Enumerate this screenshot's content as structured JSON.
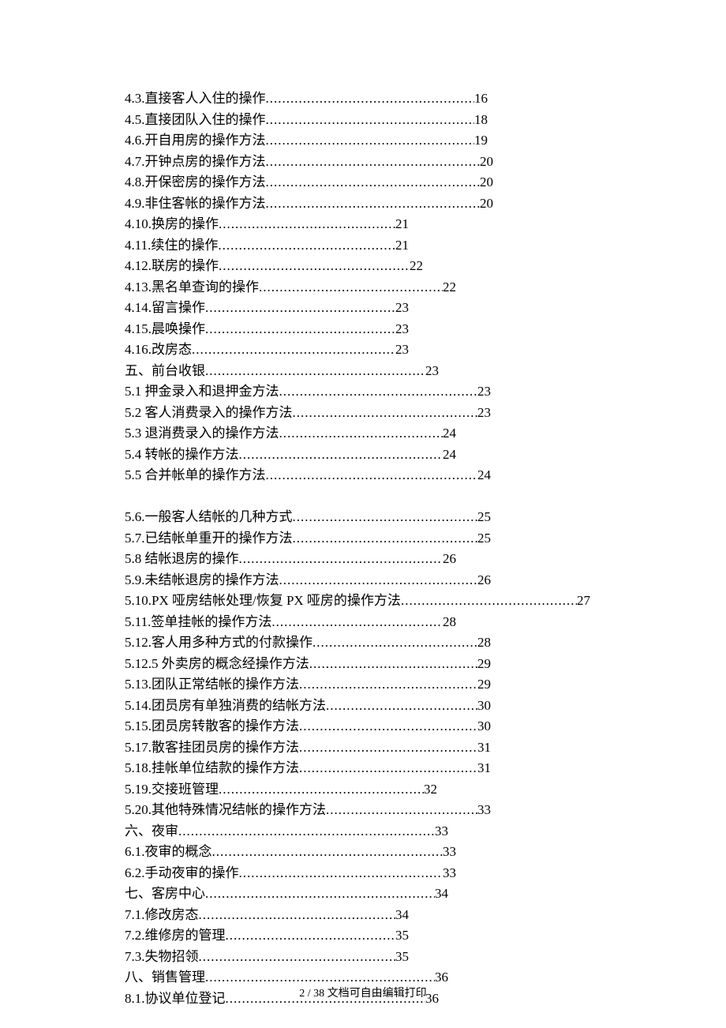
{
  "toc": [
    {
      "title": "4.3.直接客人入住的操作",
      "page": "16",
      "wClass": "w-16"
    },
    {
      "title": "4.5.直接团队入住的操作",
      "page": "18",
      "wClass": "w-18"
    },
    {
      "title": "4.6.开自用房的操作方法",
      "page": "19",
      "wClass": "w-19"
    },
    {
      "title": "4.7.开钟点房的操作方法",
      "page": "20",
      "wClass": "w-20"
    },
    {
      "title": "4.8.开保密房的操作方法",
      "page": "20",
      "wClass": "w-20"
    },
    {
      "title": "4.9.非住客帐的操作方法",
      "page": "20",
      "wClass": "w-20"
    },
    {
      "title": "4.10.换房的操作",
      "page": "21",
      "wClass": "w-21"
    },
    {
      "title": "4.11.续住的操作",
      "page": "21",
      "wClass": "w-21"
    },
    {
      "title": "4.12.联房的操作",
      "page": "22",
      "wClass": "w-22"
    },
    {
      "title": "4.13.黑名单查询的操作",
      "page": "22",
      "wClass": "w-22b"
    },
    {
      "title": "4.14.留言操作",
      "page": "23",
      "wClass": "w-23"
    },
    {
      "title": "4.15.晨唤操作",
      "page": "23",
      "wClass": "w-23"
    },
    {
      "title": "4.16.改房态",
      "page": "23",
      "wClass": "w-23"
    },
    {
      "title": "五、前台收银 ",
      "page": " 23",
      "wClass": "w-23b"
    },
    {
      "title": "5.1  押金录入和退押金方法",
      "page": "23",
      "wClass": "w-23c"
    },
    {
      "title": "5.2  客人消费录入的操作方法",
      "page": "23",
      "wClass": "w-23c"
    },
    {
      "title": "5.3  退消费录入的操作方法",
      "page": "24",
      "wClass": "w-24"
    },
    {
      "title": "5.4  转帐的操作方法",
      "page": "24",
      "wClass": "w-24"
    },
    {
      "title": "5.5  合并帐单的操作方法",
      "page": "24",
      "wClass": "w-24b"
    },
    {
      "spacer": true
    },
    {
      "title": "5.6.一般客人结帐的几种方式",
      "page": "25",
      "wClass": "w-25"
    },
    {
      "title": "5.7.已结帐单重开的操作方法",
      "page": "25",
      "wClass": "w-25"
    },
    {
      "title": "5.8  结帐退房的操作",
      "page": "26",
      "wClass": "w-26"
    },
    {
      "title": "5.9.未结帐退房的操作方法",
      "page": "26",
      "wClass": "w-26b"
    },
    {
      "title": "5.10.PX 哑房结帐处理/恢复 PX 哑房的操作方法 ",
      "page": "27",
      "wClass": "w-27"
    },
    {
      "title": "5.11.签单挂帐的操作方法",
      "page": "28",
      "wClass": "w-28"
    },
    {
      "title": "5.12.客人用多种方式的付款操作",
      "page": "28",
      "wClass": "w-28b"
    },
    {
      "title": "5.12.5 外卖房的概念经操作方法 ",
      "page": "29",
      "wClass": "w-29"
    },
    {
      "title": "5.13.团队正常结帐的操作方法",
      "page": "29",
      "wClass": "w-29"
    },
    {
      "title": "5.14.团员房有单独消费的结帐方法",
      "page": "30",
      "wClass": "w-30"
    },
    {
      "title": "5.15.团员房转散客的操作方法",
      "page": "30",
      "wClass": "w-30"
    },
    {
      "title": "5.17.散客挂团员房的操作方法",
      "page": "31",
      "wClass": "w-31"
    },
    {
      "title": "5.18.挂帐单位结款的操作方法",
      "page": "31",
      "wClass": "w-31"
    },
    {
      "title": "5.19.交接班管理",
      "page": "32",
      "wClass": "w-32"
    },
    {
      "title": "5.20.其他特殊情况结帐的操作方法",
      "page": "33",
      "wClass": "w-33"
    },
    {
      "title": "六、夜审 ",
      "page": " 33",
      "wClass": "w-33h"
    },
    {
      "title": "6.1.夜审的概念",
      "page": "33",
      "wClass": "w-33b"
    },
    {
      "title": "6.2.手动夜审的操作",
      "page": "33",
      "wClass": "w-33b"
    },
    {
      "title": "七、客房中心 ",
      "page": " 34",
      "wClass": "w-34"
    },
    {
      "title": "7.1.修改房态",
      "page": "34",
      "wClass": "w-34b"
    },
    {
      "title": "7.2.维修房的管理",
      "page": "35",
      "wClass": "w-35"
    },
    {
      "title": "7.3.失物招领",
      "page": "35",
      "wClass": "w-35"
    },
    {
      "title": "八、销售管理 ",
      "page": " 36",
      "wClass": "w-36"
    },
    {
      "title": "8.1.协议单位登记",
      "page": "36",
      "wClass": "w-36b"
    }
  ],
  "footer": "2 / 38 文档可自由编辑打印"
}
